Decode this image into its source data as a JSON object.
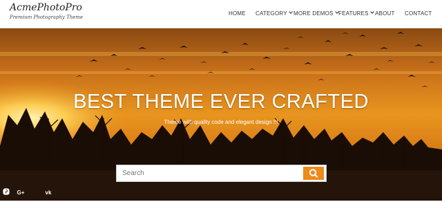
{
  "site": {
    "title": "AcmePhotoPro",
    "tagline": "Premium Photography Theme"
  },
  "nav": {
    "items": [
      {
        "label": "HOME",
        "dropdown": false
      },
      {
        "label": "CATEGORY",
        "dropdown": true
      },
      {
        "label": "MORE DEMOS",
        "dropdown": true
      },
      {
        "label": "FEATURES",
        "dropdown": true
      },
      {
        "label": "ABOUT",
        "dropdown": false
      },
      {
        "label": "CONTACT",
        "dropdown": false
      }
    ]
  },
  "hero": {
    "title": "BEST THEME EVER CRAFTED",
    "subtitle": "Theme with quality code and elegant design !!!",
    "background": "sunset photo with flying birds and silhouetted trees"
  },
  "search": {
    "placeholder": "Search",
    "button_icon": "search-icon"
  },
  "social": {
    "icons": [
      "instagram-icon",
      "google-plus-icon",
      "pinterest-icon",
      "vk-icon"
    ],
    "labels": [
      "",
      "G+",
      "",
      "vk"
    ]
  },
  "colors": {
    "accent": "#ec8a1c",
    "header_bg": "#ffffff",
    "text_dark": "#333333"
  }
}
